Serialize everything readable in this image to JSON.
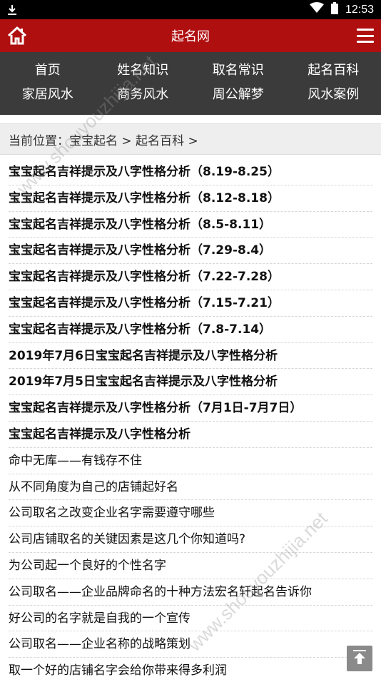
{
  "status_bar": {
    "time": "12:53"
  },
  "header": {
    "title": "起名网"
  },
  "nav": {
    "items": [
      "首页",
      "姓名知识",
      "取名常识",
      "起名百科",
      "家居风水",
      "商务风水",
      "周公解梦",
      "风水案例"
    ]
  },
  "breadcrumb": {
    "text": "当前位置：宝宝起名 > 起名百科 >"
  },
  "articles": [
    {
      "title": "宝宝起名吉祥提示及八字性格分析（8.19-8.25）",
      "bold": true
    },
    {
      "title": "宝宝起名吉祥提示及八字性格分析（8.12-8.18）",
      "bold": true
    },
    {
      "title": "宝宝起名吉祥提示及八字性格分析（8.5-8.11）",
      "bold": true
    },
    {
      "title": "宝宝起名吉祥提示及八字性格分析（7.29-8.4）",
      "bold": true
    },
    {
      "title": "宝宝起名吉祥提示及八字性格分析（7.22-7.28）",
      "bold": true
    },
    {
      "title": "宝宝起名吉祥提示及八字性格分析（7.15-7.21）",
      "bold": true
    },
    {
      "title": "宝宝起名吉祥提示及八字性格分析（7.8-7.14）",
      "bold": true
    },
    {
      "title": "2019年7月6日宝宝起名吉祥提示及八字性格分析",
      "bold": true
    },
    {
      "title": "2019年7月5日宝宝起名吉祥提示及八字性格分析",
      "bold": true
    },
    {
      "title": "宝宝起名吉祥提示及八字性格分析（7月1日-7月7日）",
      "bold": true
    },
    {
      "title": "宝宝起名吉祥提示及八字性格分析",
      "bold": true
    },
    {
      "title": "命中无库——有钱存不住",
      "bold": false
    },
    {
      "title": "从不同角度为自己的店铺起好名",
      "bold": false
    },
    {
      "title": "公司取名之改变企业名字需要遵守哪些",
      "bold": false
    },
    {
      "title": "公司店铺取名的关键因素是这几个你知道吗?",
      "bold": false
    },
    {
      "title": "为公司起一个良好的个性名字",
      "bold": false
    },
    {
      "title": "公司取名——企业品牌命名的十种方法宏名轩起名告诉你",
      "bold": false
    },
    {
      "title": "好公司的名字就是自我的一个宣传",
      "bold": false
    },
    {
      "title": "公司取名——企业名称的战略策划",
      "bold": false
    },
    {
      "title": "取一个好的店铺名字会给你带来得多利润",
      "bold": false
    }
  ],
  "watermarks": [
    "www.shouyouzhijia.net",
    "www.shouyouzhijia.net"
  ],
  "colors": {
    "header_red": "#b00f10",
    "nav_bg": "#3b3b3b"
  }
}
